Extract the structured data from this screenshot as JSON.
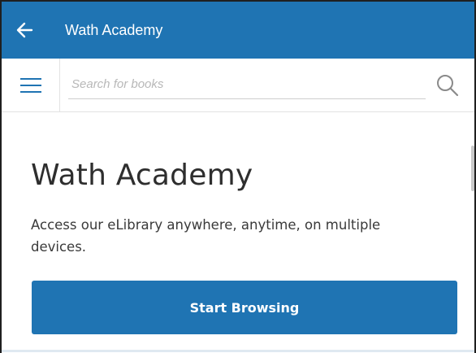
{
  "appbar": {
    "title": "Wath Academy",
    "back_icon": "arrow-left-icon",
    "background": "#1f74b3"
  },
  "search": {
    "menu_icon": "hamburger-menu-icon",
    "placeholder": "Search for books",
    "value": "",
    "search_icon": "magnifier-icon",
    "accent": "#1f74b3"
  },
  "hero": {
    "title": "Wath Academy",
    "description": "Access our eLibrary anywhere, anytime, on multiple devices.",
    "button_label": "Start Browsing",
    "button_color": "#1f74b3"
  }
}
